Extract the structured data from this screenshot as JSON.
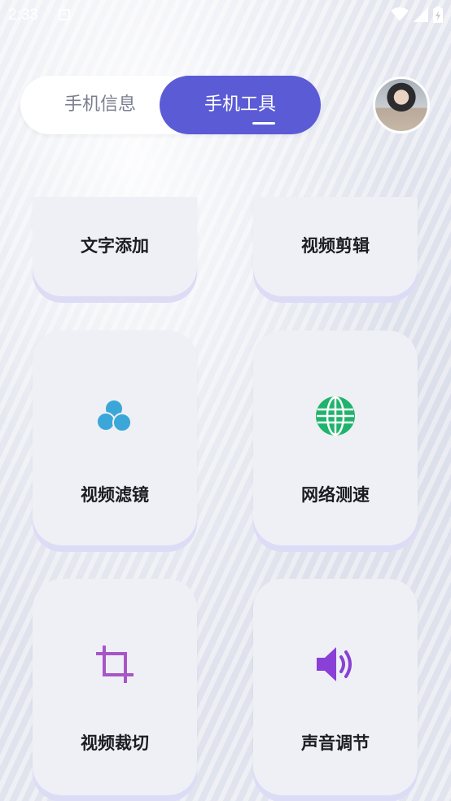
{
  "status_bar": {
    "time": "2:33",
    "notif_icon": "A"
  },
  "tabs": {
    "info_label": "手机信息",
    "tools_label": "手机工具",
    "active": "tools",
    "accent_color": "#5b5bd6"
  },
  "tools": [
    {
      "label": "文字添加",
      "icon": null
    },
    {
      "label": "视频剪辑",
      "icon": null
    },
    {
      "label": "视频滤镜",
      "icon": "three-circles-icon",
      "color": "#3aa7d8"
    },
    {
      "label": "网络测速",
      "icon": "globe-icon",
      "color": "#1fb36b"
    },
    {
      "label": "视频裁切",
      "icon": "crop-icon",
      "color": "#a855c7"
    },
    {
      "label": "声音调节",
      "icon": "speaker-icon",
      "color": "#8a3fd6"
    }
  ]
}
